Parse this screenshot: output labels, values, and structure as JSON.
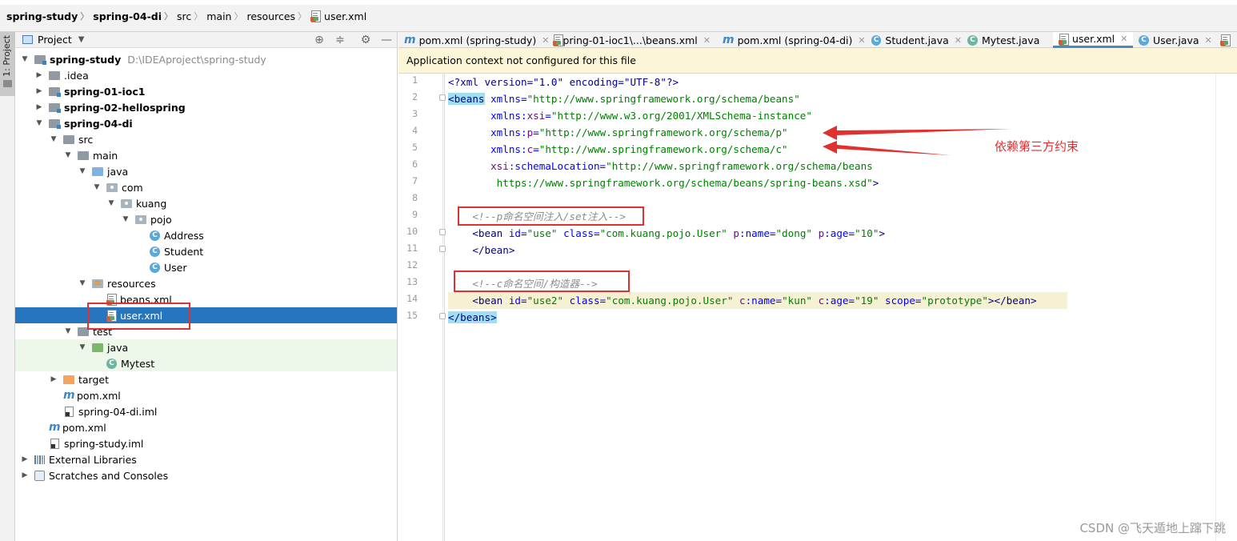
{
  "breadcrumb": [
    "spring-study",
    "spring-04-di",
    "src",
    "main",
    "resources",
    "user.xml"
  ],
  "project_panel": {
    "title": "Project",
    "side_tab": "1: Project",
    "tree": [
      {
        "label": "spring-study",
        "hint": "D:\\IDEAproject\\spring-study",
        "bold": true
      },
      {
        "label": ".idea"
      },
      {
        "label": "spring-01-ioc1",
        "bold": true
      },
      {
        "label": "spring-02-hellospring",
        "bold": true
      },
      {
        "label": "spring-04-di",
        "bold": true
      },
      {
        "label": "src"
      },
      {
        "label": "main"
      },
      {
        "label": "java"
      },
      {
        "label": "com"
      },
      {
        "label": "kuang"
      },
      {
        "label": "pojo"
      },
      {
        "label": "Address"
      },
      {
        "label": "Student"
      },
      {
        "label": "User"
      },
      {
        "label": "resources"
      },
      {
        "label": "beans.xml"
      },
      {
        "label": "user.xml",
        "selected": true
      },
      {
        "label": "test"
      },
      {
        "label": "java"
      },
      {
        "label": "Mytest"
      },
      {
        "label": "target"
      },
      {
        "label": "pom.xml"
      },
      {
        "label": "spring-04-di.iml"
      },
      {
        "label": "pom.xml"
      },
      {
        "label": "spring-study.iml"
      },
      {
        "label": "External Libraries"
      },
      {
        "label": "Scratches and Consoles"
      }
    ]
  },
  "editor": {
    "tabs": [
      {
        "label": "pom.xml (spring-study)",
        "icon": "maven-icon"
      },
      {
        "label": "spring-01-ioc1\\...\\beans.xml",
        "icon": "xml-icon"
      },
      {
        "label": "pom.xml (spring-04-di)",
        "icon": "maven-icon"
      },
      {
        "label": "Student.java",
        "icon": "class-icon"
      },
      {
        "label": "Mytest.java",
        "icon": "test-class-icon"
      },
      {
        "label": "user.xml",
        "icon": "xml-icon",
        "active": true
      },
      {
        "label": "User.java",
        "icon": "class-icon"
      }
    ],
    "banner": "Application context not configured for this file",
    "line_numbers": [
      "1",
      "2",
      "3",
      "4",
      "5",
      "6",
      "7",
      "8",
      "9",
      "10",
      "11",
      "12",
      "13",
      "14",
      "15"
    ],
    "annotation": "依赖第三方约束",
    "code": {
      "l1": "<?xml version=\"1.0\" encoding=\"UTF-8\"?>",
      "l2a": "<beans",
      "l2b": " xmlns=",
      "l2c": "\"http://www.springframework.org/schema/beans\"",
      "l3a": "       xmlns:",
      "l3b": "xsi",
      "l3c": "=",
      "l3d": "\"http://www.w3.org/2001/XMLSchema-instance\"",
      "l4a": "       xmlns:",
      "l4b": "p",
      "l4c": "=",
      "l4d": "\"http://www.springframework.org/schema/p\"",
      "l5a": "       xmlns:",
      "l5b": "c",
      "l5c": "=",
      "l5d": "\"http://www.springframework.org/schema/c\"",
      "l6a": "       ",
      "l6b": "xsi",
      "l6c": ":schemaLocation=",
      "l6d": "\"http://www.springframework.org/schema/beans",
      "l7": "        https://www.springframework.org/schema/beans/spring-beans.xsd\"",
      "l7end": ">",
      "l9": "    <!--p命名空间注入/set注入-->",
      "l10a": "    <bean",
      "l10b": " id=",
      "l10c": "\"use\"",
      "l10d": " class=",
      "l10e": "\"com.kuang.pojo.User\"",
      "l10f": " p",
      "l10g": ":name=",
      "l10h": "\"dong\"",
      "l10i": " p",
      "l10j": ":age=",
      "l10k": "\"10\"",
      "l10l": ">",
      "l11": "    </bean>",
      "l13": "    <!--c命名空间/构造器-->",
      "l14a": "    <bean",
      "l14b": " id=",
      "l14c": "\"use2\"",
      "l14d": " class=",
      "l14e": "\"com.kuang.pojo.User\"",
      "l14f": " c",
      "l14g": ":name=",
      "l14h": "\"kun\"",
      "l14i": " c",
      "l14j": ":age=",
      "l14k": "\"19\"",
      "l14l": " scope=",
      "l14m": "\"prototype\"",
      "l14n": "></bean>",
      "l15": "</beans>"
    }
  },
  "watermark": "CSDN @飞天遁地上蹿下跳",
  "colors": {
    "selection": "#2675bf",
    "annotation": "#e03030",
    "banner": "#fbf6d7"
  }
}
